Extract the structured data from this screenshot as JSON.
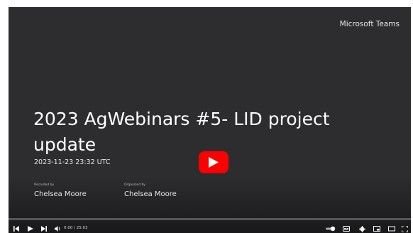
{
  "video": {
    "brand": "Microsoft Teams",
    "title": "2023 AgWebinars #5- LID project update",
    "datetime": "2023-11-23 23:32 UTC",
    "recorded_by_label": "Recorded by",
    "recorded_by": "Chelsea Moore",
    "organized_by_label": "Organized by",
    "organized_by": "Chelsea Moore"
  },
  "player": {
    "time_display": "0:00 / 25:03",
    "progress_fraction": 0,
    "accent_color": "#ff0000",
    "background_color": "#2d2d30",
    "icons": [
      "previous-icon",
      "play-icon",
      "next-icon",
      "volume-icon",
      "autoplay-toggle-icon",
      "subtitles-icon",
      "settings-icon",
      "miniplayer-icon",
      "theater-icon",
      "fullscreen-icon"
    ]
  }
}
